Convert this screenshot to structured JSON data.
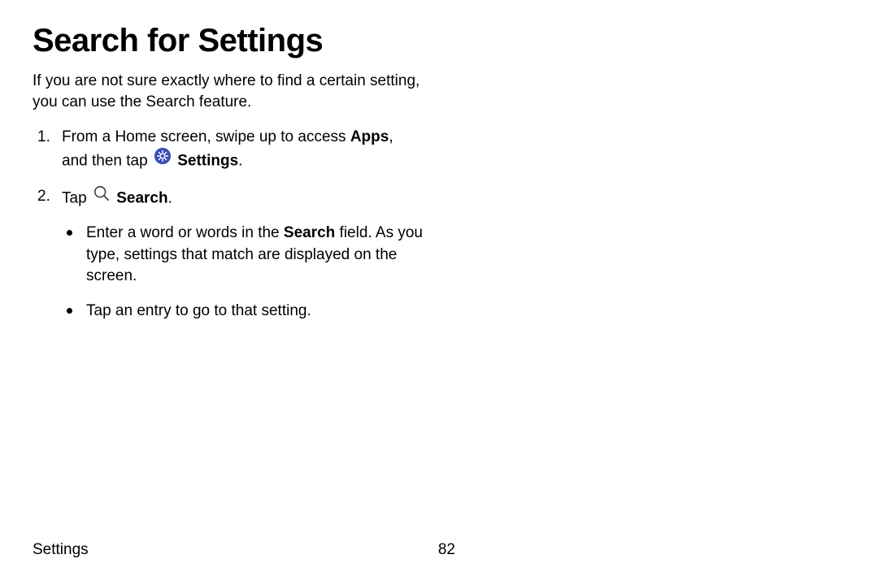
{
  "title": "Search for Settings",
  "intro": "If you are not sure exactly where to find a certain setting, you can use the Search feature.",
  "steps": {
    "step1_a": "From a Home screen, swipe up to access ",
    "step1_apps": "Apps",
    "step1_b": ", and then tap ",
    "step1_settings": "Settings",
    "step1_period": ".",
    "step2_a": "Tap ",
    "step2_search": "Search",
    "step2_period": ".",
    "sub1_a": "Enter a word or words in the ",
    "sub1_search": "Search",
    "sub1_b": " field. As you type, settings that match are displayed on the screen.",
    "sub2": "Tap an entry to go to that setting."
  },
  "footer": {
    "section": "Settings",
    "page": "82"
  }
}
